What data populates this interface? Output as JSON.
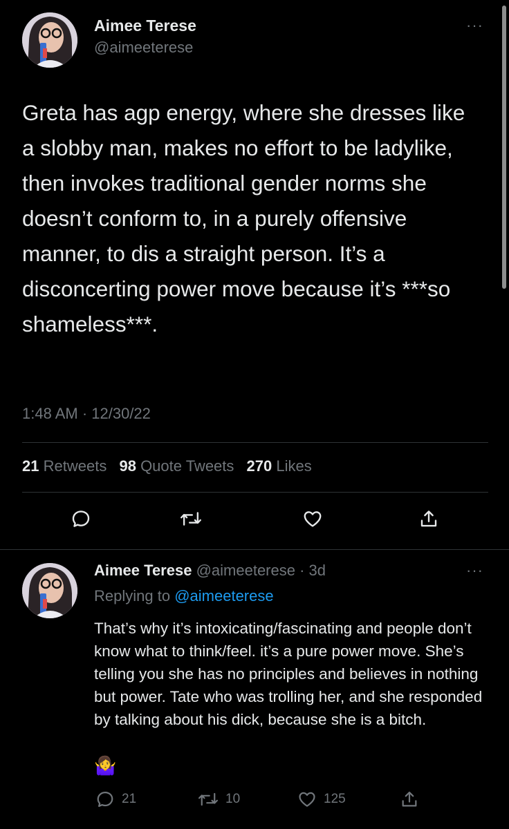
{
  "main_tweet": {
    "display_name": "Aimee Terese",
    "handle": "@aimeeterese",
    "more": "···",
    "text": "Greta has agp energy, where she dresses like a slobby man, makes no effort to be ladylike, then invokes traditional gender norms she doesn’t conform to, in a purely offensive manner, to dis a straight person. It’s a disconcerting power move because it’s ***so shameless***.",
    "timestamp": "1:48 AM · 12/30/22",
    "stats": {
      "retweets_count": "21",
      "retweets_label": "Retweets",
      "quotes_count": "98",
      "quotes_label": "Quote Tweets",
      "likes_count": "270",
      "likes_label": "Likes"
    },
    "actions": [
      "reply-icon",
      "retweet-icon",
      "like-icon",
      "share-icon"
    ]
  },
  "reply_tweet": {
    "display_name": "Aimee Terese",
    "meta": "@aimeeterese · 3d",
    "more": "···",
    "replying_prefix": "Replying to",
    "replying_handle": "@aimeeterese",
    "text": "That’s why it’s intoxicating/fascinating and people don’t know what to think/feel. it’s a pure power move. She’s telling you she has no principles and believes in nothing but power. Tate who was trolling her, and she responded by talking about his dick, because she is a bitch.",
    "emoji": "🤷‍♀️",
    "reply_count": "21",
    "retweet_count": "10",
    "like_count": "125"
  },
  "colors": {
    "background": "#000000",
    "text": "#e7e9ea",
    "muted": "#71767b",
    "link": "#1d9bf0",
    "divider": "#2f3336"
  }
}
